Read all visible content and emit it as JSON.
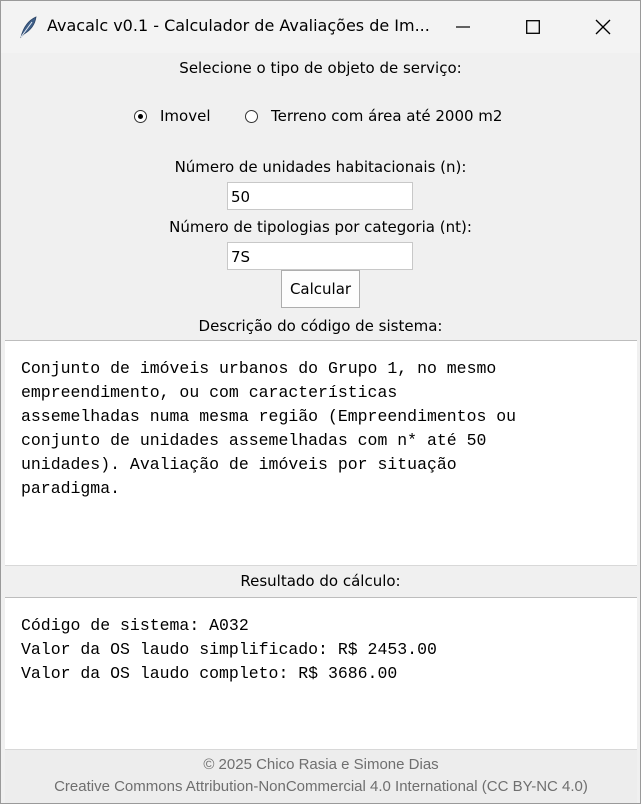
{
  "window": {
    "title": "Avacalc v0.1 - Calculador de Avaliações de Im..."
  },
  "form": {
    "type_prompt": "Selecione o tipo de objeto de serviço:",
    "radio_options": [
      {
        "label": "Imovel",
        "selected": true
      },
      {
        "label": "Terreno com área até 2000 m2",
        "selected": false
      }
    ],
    "units_label": "Número de unidades habitacionais (n):",
    "units_value": "50",
    "typologies_label": "Número de tipologias por categoria (nt):",
    "typologies_value": "7S",
    "calculate_label": "Calcular"
  },
  "description": {
    "header": "Descrição do código de sistema:",
    "text": "Conjunto de imóveis urbanos do Grupo 1, no mesmo\nempreendimento, ou com características\nassemelhadas numa mesma região (Empreendimentos ou\nconjunto de unidades assemelhadas com n* até 50\nunidades). Avaliação de imóveis por situação\nparadigma."
  },
  "result": {
    "header": "Resultado do cálculo:",
    "text": "Código de sistema: A032\nValor da OS laudo simplificado: R$ 2453.00\nValor da OS laudo completo: R$ 3686.00"
  },
  "footer": {
    "copyright": "© 2025 Chico Rasia e Simone Dias",
    "license": "Creative Commons Attribution-NonCommercial 4.0 International (CC BY-NC 4.0)"
  },
  "icons": {
    "app": "feather-icon",
    "minimize": "minimize-icon",
    "maximize": "maximize-icon",
    "close": "close-icon"
  },
  "colors": {
    "window_bg": "#f0f0f0",
    "footer_text": "#6f6f6f",
    "feather": "#3f5f88"
  }
}
